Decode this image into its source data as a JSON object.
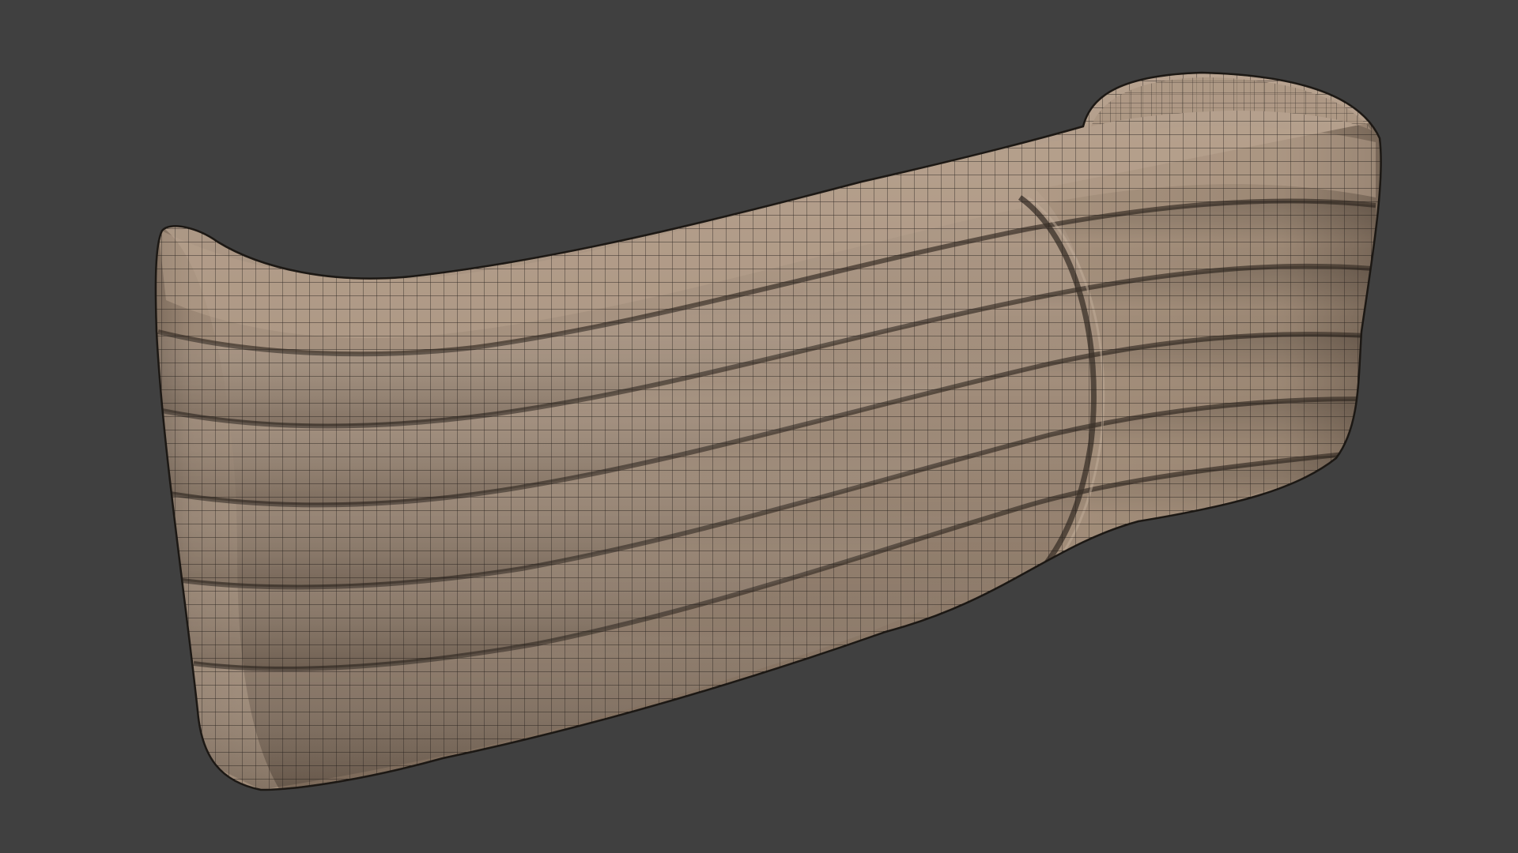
{
  "viewport": {
    "background_color": "#404040",
    "shading": "solid-with-wireframe"
  },
  "model": {
    "object": "curved-sofa-back",
    "view": "rear-three-quarter",
    "surface_color": "#9e8a78",
    "surface_shadow_color": "#6e5e50",
    "surface_highlight_color": "#bca896",
    "wire_color": "#1e1a16",
    "channel_count": 6
  }
}
